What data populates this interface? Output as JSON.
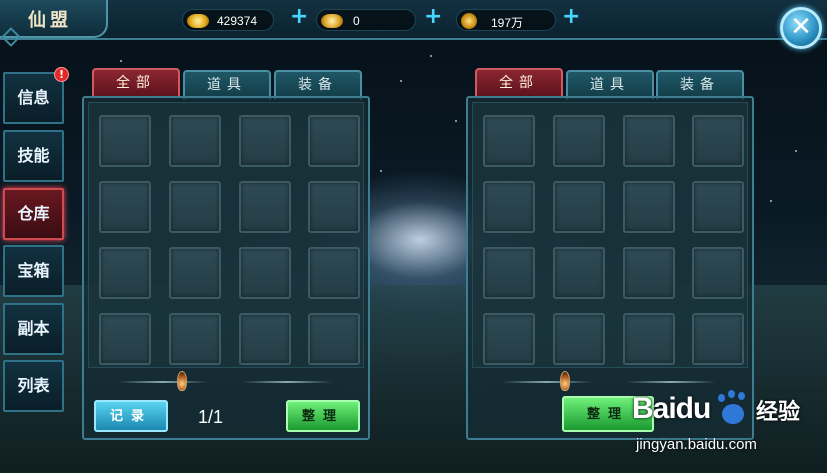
{
  "header": {
    "title": "仙盟",
    "currencies": [
      {
        "icon": "gold-ingot-icon",
        "value": "429374",
        "color": "#f2c232"
      },
      {
        "icon": "silver-ingot-icon",
        "value": "0",
        "color": "#e8b838"
      },
      {
        "icon": "coin-icon",
        "value": "197万",
        "color": "#e0a020"
      }
    ],
    "plus": "+"
  },
  "sidebar": {
    "items": [
      {
        "label": "信息",
        "active": false
      },
      {
        "label": "技能",
        "active": false
      },
      {
        "label": "仓库",
        "active": true
      },
      {
        "label": "宝箱",
        "active": false
      },
      {
        "label": "副本",
        "active": false
      },
      {
        "label": "列表",
        "active": false
      }
    ],
    "badge": "!"
  },
  "left_panel": {
    "tabs": [
      {
        "label": "全部",
        "active": true
      },
      {
        "label": "道具",
        "active": false
      },
      {
        "label": "装备",
        "active": false
      }
    ],
    "record_button": "记录",
    "page": "1/1",
    "sort_button": "整理"
  },
  "right_panel": {
    "tabs": [
      {
        "label": "全部",
        "active": true
      },
      {
        "label": "道具",
        "active": false
      },
      {
        "label": "装备",
        "active": false
      }
    ],
    "sort_button": "整理"
  },
  "watermark": {
    "logo": "Baidu",
    "cn": "经验",
    "url": "jingyan.baidu.com"
  },
  "colors": {
    "accent": "#3d7d92",
    "active_tab": "#8b2632",
    "button_blue": "#1a88b0",
    "button_green": "#1a9a30"
  }
}
